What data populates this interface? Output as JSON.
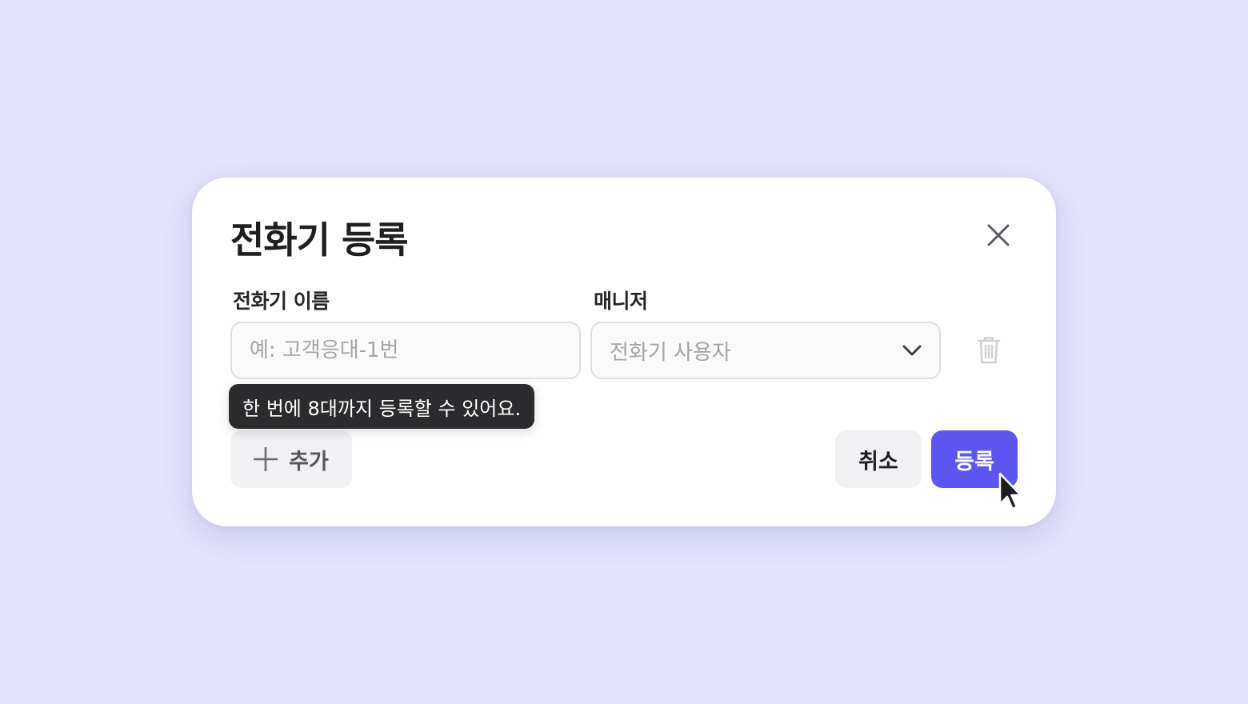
{
  "dialog": {
    "title": "전화기 등록",
    "close_icon": "close-icon"
  },
  "form": {
    "name_label": "전화기 이름",
    "name_placeholder": "예: 고객응대-1번",
    "name_value": "",
    "manager_label": "매니저",
    "manager_selected": "전화기 사용자",
    "manager_icon": "chevron-down-icon",
    "delete_icon": "trash-icon"
  },
  "tooltip": {
    "text": "한 번에 8대까지 등록할 수 있어요."
  },
  "actions": {
    "add_icon": "plus-icon",
    "add_label": "추가",
    "cancel_label": "취소",
    "submit_label": "등록"
  },
  "colors": {
    "background": "#e3e3fd",
    "primary": "#5b55f2",
    "tooltip_bg": "#2b2b2e"
  }
}
